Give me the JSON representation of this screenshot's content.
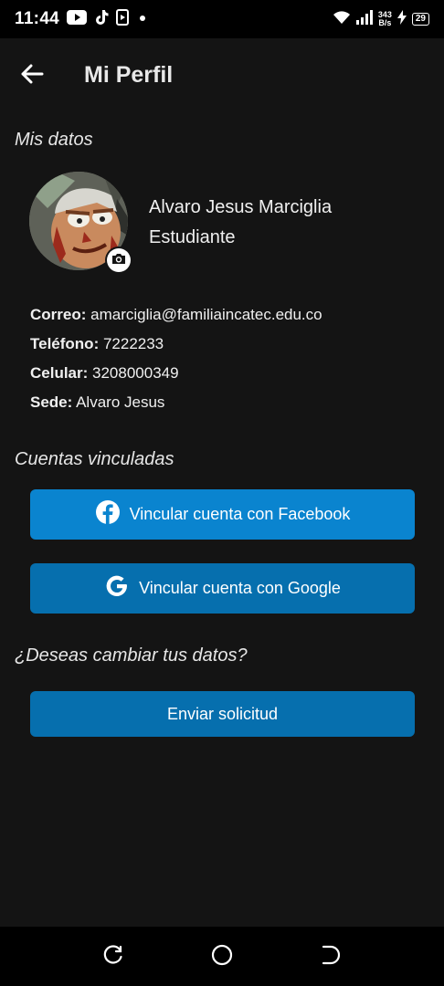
{
  "status_bar": {
    "time": "11:44",
    "net_speed_value": "343",
    "net_speed_unit": "B/s",
    "battery": "29",
    "icons": [
      "youtube-icon",
      "tiktok-icon",
      "media-icon",
      "dot-icon",
      "wifi-icon",
      "signal-icon",
      "charging-icon",
      "battery-icon"
    ]
  },
  "header": {
    "back_icon": "arrow-left-icon",
    "title": "Mi Perfil"
  },
  "profile": {
    "section_title": "Mis datos",
    "name": "Alvaro Jesus Marciglia",
    "role": "Estudiante",
    "camera_icon": "camera-icon",
    "fields": [
      {
        "label": "Correo:",
        "value": " amarciglia@familiaincatec.edu.co"
      },
      {
        "label": "Teléfono:",
        "value": " 7222233"
      },
      {
        "label": "Celular:",
        "value": " 3208000349"
      },
      {
        "label": "Sede:",
        "value": " Alvaro Jesus"
      }
    ]
  },
  "linked": {
    "section_title": "Cuentas vinculadas",
    "facebook_label": "Vincular cuenta con Facebook",
    "google_label": "Vincular cuenta con Google"
  },
  "change": {
    "section_title": "¿Deseas cambiar tus datos?",
    "send_label": "Enviar solicitud"
  },
  "colors": {
    "background": "#141414",
    "facebook_button": "#0a84cf",
    "primary_button": "#066fae"
  },
  "nav_bar": {
    "icons": [
      "recents-icon",
      "home-icon",
      "back-nav-icon"
    ]
  }
}
